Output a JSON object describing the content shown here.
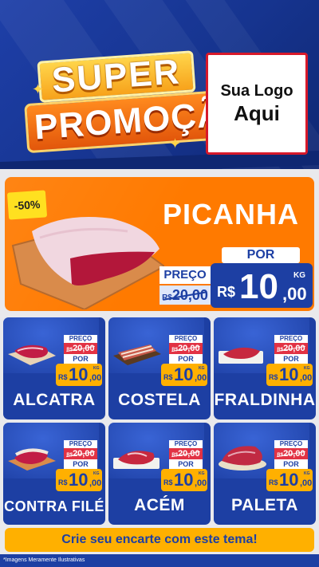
{
  "header": {
    "title_line1": "SUPER",
    "title_line2": "PROMOÇÃO",
    "logo_line1": "Sua Logo",
    "logo_line2": "Aqui"
  },
  "featured": {
    "discount": "-50%",
    "name": "PICANHA",
    "preco_label": "PREÇO",
    "old_currency": "R$",
    "old_price": "20,00",
    "por_label": "POR",
    "currency": "R$",
    "price_int": "10",
    "price_dec": ",00",
    "unit": "KG"
  },
  "products": [
    {
      "name": "ALCATRA",
      "preco_label": "PREÇO",
      "old_currency": "R$",
      "old_price": "20,00",
      "por_label": "POR",
      "currency": "R$",
      "price_int": "10",
      "price_dec": ",00",
      "unit": "KG"
    },
    {
      "name": "COSTELA",
      "preco_label": "PREÇO",
      "old_currency": "R$",
      "old_price": "20,00",
      "por_label": "POR",
      "currency": "R$",
      "price_int": "10",
      "price_dec": ",00",
      "unit": "KG"
    },
    {
      "name": "FRALDINHA",
      "preco_label": "PREÇO",
      "old_currency": "R$",
      "old_price": "20,00",
      "por_label": "POR",
      "currency": "R$",
      "price_int": "10",
      "price_dec": ",00",
      "unit": "KG"
    },
    {
      "name": "CONTRA FILÉ",
      "preco_label": "PREÇO",
      "old_currency": "R$",
      "old_price": "20,00",
      "por_label": "POR",
      "currency": "R$",
      "price_int": "10",
      "price_dec": ",00",
      "unit": "KG"
    },
    {
      "name": "ACÉM",
      "preco_label": "PREÇO",
      "old_currency": "R$",
      "old_price": "20,00",
      "por_label": "POR",
      "currency": "R$",
      "price_int": "10",
      "price_dec": ",00",
      "unit": "KG"
    },
    {
      "name": "PALETA",
      "preco_label": "PREÇO",
      "old_currency": "R$",
      "old_price": "20,00",
      "por_label": "POR",
      "currency": "R$",
      "price_int": "10",
      "price_dec": ",00",
      "unit": "KG"
    }
  ],
  "footer": {
    "cta": "Crie seu encarte com este tema!",
    "disclaimer": "*Imagens Meramente Ilustrativas"
  },
  "colors": {
    "brand_blue": "#1d3fa3",
    "accent_orange": "#ff7a00",
    "price_yellow": "#ffb000",
    "old_price_red": "#e23244"
  }
}
